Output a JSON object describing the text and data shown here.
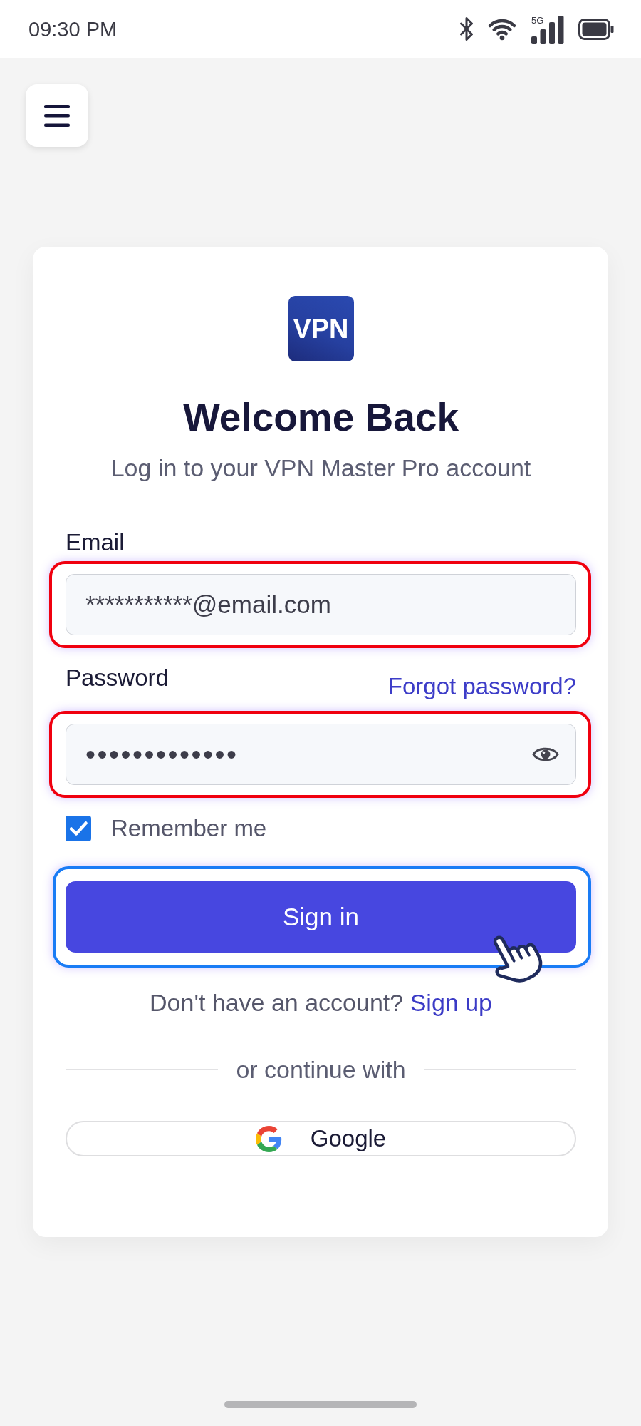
{
  "status_bar": {
    "time": "09:30 PM",
    "network_label": "5G"
  },
  "login_card": {
    "logo_text": "VPN",
    "title": "Welcome Back",
    "subtitle": "Log in to your VPN Master Pro account",
    "fields": [
      {
        "kind": "email",
        "label": "Email",
        "value": "***********@email.com",
        "highlighted": true
      },
      {
        "kind": "password",
        "label": "Password",
        "link": "Forgot password?",
        "value": "•••••••••••••",
        "highlighted": true
      }
    ],
    "remember_me": {
      "label": "Remember me",
      "checked": true
    },
    "sign_in_button": {
      "label": "Sign in",
      "highlighted": true
    },
    "signup_prompt": {
      "text": "Don't have an account?",
      "link": "Sign up"
    },
    "divider_text": "or continue with",
    "social_buttons": [
      {
        "kind": "google",
        "label": "Google"
      }
    ]
  }
}
